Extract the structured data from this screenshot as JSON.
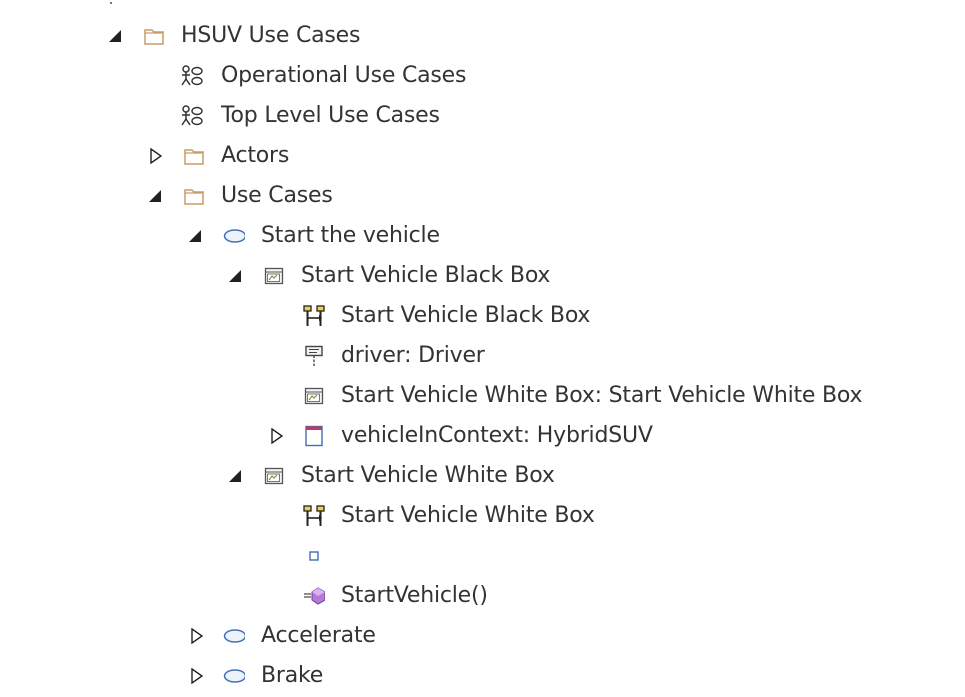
{
  "tree": {
    "root": {
      "label": "HSUV Use Cases",
      "icon": "folder-icon",
      "expanded": true
    },
    "operational": {
      "label": "Operational Use Cases",
      "icon": "use-case-diagram-icon"
    },
    "top_level": {
      "label": "Top Level Use Cases",
      "icon": "use-case-diagram-icon"
    },
    "actors": {
      "label": "Actors",
      "icon": "folder-icon",
      "expanded": false
    },
    "use_cases": {
      "label": "Use Cases",
      "icon": "folder-icon",
      "expanded": true
    },
    "start_vehicle": {
      "label": "Start the vehicle",
      "icon": "use-case-icon",
      "expanded": true
    },
    "black_box": {
      "label": "Start Vehicle Black Box",
      "icon": "interaction-icon",
      "expanded": true
    },
    "black_box_diagram": {
      "label": "Start Vehicle Black Box",
      "icon": "sequence-diagram-icon"
    },
    "driver": {
      "label": "driver: Driver",
      "icon": "lifeline-icon"
    },
    "white_box_ref": {
      "label": "Start Vehicle White Box: Start Vehicle White Box",
      "icon": "interaction-icon"
    },
    "vehicle_in_context": {
      "label": "vehicleInContext: HybridSUV",
      "icon": "property-icon",
      "expanded": false
    },
    "white_box": {
      "label": "Start Vehicle White Box",
      "icon": "interaction-icon",
      "expanded": true
    },
    "white_box_diagram": {
      "label": "Start Vehicle White Box",
      "icon": "sequence-diagram-icon"
    },
    "unnamed_element": {
      "label": "",
      "icon": "small-square-icon"
    },
    "start_vehicle_op": {
      "label": "StartVehicle()",
      "icon": "operation-icon"
    },
    "accelerate": {
      "label": "Accelerate",
      "icon": "use-case-icon",
      "expanded": false
    },
    "brake": {
      "label": "Brake",
      "icon": "use-case-icon",
      "expanded": false
    }
  },
  "colors": {
    "text": "#333333",
    "folder_stroke": "#c89b68",
    "use_case_stroke": "#3f6fb5",
    "use_case_fill": "#eef3fb",
    "operation_accent": "#8a4fb8",
    "toggle": "#222222"
  }
}
